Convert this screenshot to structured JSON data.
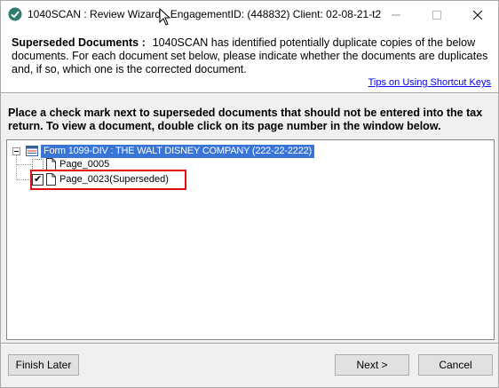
{
  "window": {
    "title": "1040SCAN : Review Wizard - EngagementID: (448832)  Client: 02-08-21-t2"
  },
  "header": {
    "label": "Superseded Documents :",
    "description": "1040SCAN has identified potentially duplicate copies of the below documents. For each document set below, please indicate whether the documents are duplicates and, if so, which one is the corrected document.",
    "tips_link": "Tips on Using Shortcut Keys"
  },
  "instructions": "Place a check mark next to superseded documents that should not be entered into the tax return. To view a document, double click on its page number in the window below.",
  "tree": {
    "root_label": "Form 1099-DIV : THE WALT DISNEY COMPANY (222-22-2222)",
    "children": [
      {
        "label": "Page_0005",
        "checked": false
      },
      {
        "label": "Page_0023(Superseded)",
        "checked": true
      }
    ]
  },
  "buttons": {
    "finish_later": "Finish Later",
    "next": "Next >",
    "cancel": "Cancel"
  },
  "colors": {
    "selection": "#3875d7",
    "highlight": "#e01010",
    "link": "#0000ee"
  }
}
